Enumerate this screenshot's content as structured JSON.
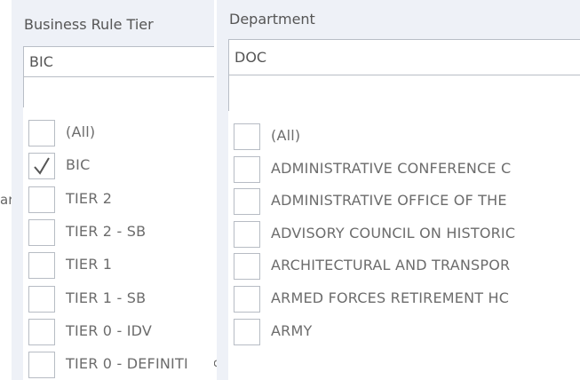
{
  "background_fragments": {
    "left_fragment": "ar",
    "middle_fragment": "rc"
  },
  "tier_filter": {
    "title": "Business Rule Tier",
    "selected_value": "BIC",
    "search_value": "",
    "options": [
      {
        "label": "(All)",
        "checked": false
      },
      {
        "label": "BIC",
        "checked": true
      },
      {
        "label": "TIER 2",
        "checked": false
      },
      {
        "label": "TIER 2 - SB",
        "checked": false
      },
      {
        "label": "TIER 1",
        "checked": false
      },
      {
        "label": "TIER 1 - SB",
        "checked": false
      },
      {
        "label": "TIER 0 - IDV",
        "checked": false
      },
      {
        "label": "TIER 0 - DEFINITI",
        "checked": false
      }
    ]
  },
  "department_filter": {
    "title": "Department",
    "selected_value": "DOC",
    "search_value": "",
    "options": [
      {
        "label": "(All)",
        "checked": false
      },
      {
        "label": "ADMINISTRATIVE CONFERENCE C",
        "checked": false
      },
      {
        "label": "ADMINISTRATIVE OFFICE OF THE",
        "checked": false
      },
      {
        "label": "ADVISORY COUNCIL ON HISTORIC",
        "checked": false
      },
      {
        "label": "ARCHITECTURAL AND TRANSPOR",
        "checked": false
      },
      {
        "label": "ARMED FORCES RETIREMENT HC",
        "checked": false
      },
      {
        "label": "ARMY",
        "checked": false
      }
    ]
  },
  "colors": {
    "panel_bg": "#eef1f7",
    "border": "#b9bec6",
    "text": "#555555"
  }
}
